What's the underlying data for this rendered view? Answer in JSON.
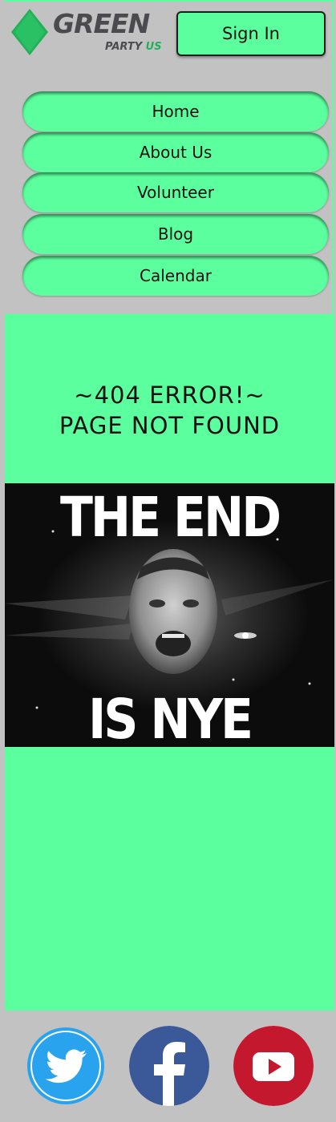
{
  "header": {
    "logo": {
      "word1": "GREEN",
      "word2": "PARTY",
      "word3": "US"
    },
    "signin_label": "Sign In"
  },
  "nav": {
    "items": [
      {
        "label": "Home"
      },
      {
        "label": "About Us"
      },
      {
        "label": "Volunteer"
      },
      {
        "label": "Blog"
      },
      {
        "label": "Calendar"
      }
    ]
  },
  "main": {
    "error_line1": "~404 ERROR!~",
    "error_line2": "PAGE NOT FOUND",
    "meme": {
      "top_text": "THE END",
      "bottom_text": "IS NYE"
    }
  },
  "footer": {
    "social": [
      {
        "icon": "twitter-icon",
        "color": "#2aa3ef"
      },
      {
        "icon": "facebook-icon",
        "color": "#3b5998"
      },
      {
        "icon": "youtube-icon",
        "color": "#c4182e"
      }
    ]
  },
  "colors": {
    "accent": "#5cff9e",
    "header_bg": "#c2c2c2",
    "logo_text": "#4a4a4f",
    "logo_us": "#23b05a"
  }
}
